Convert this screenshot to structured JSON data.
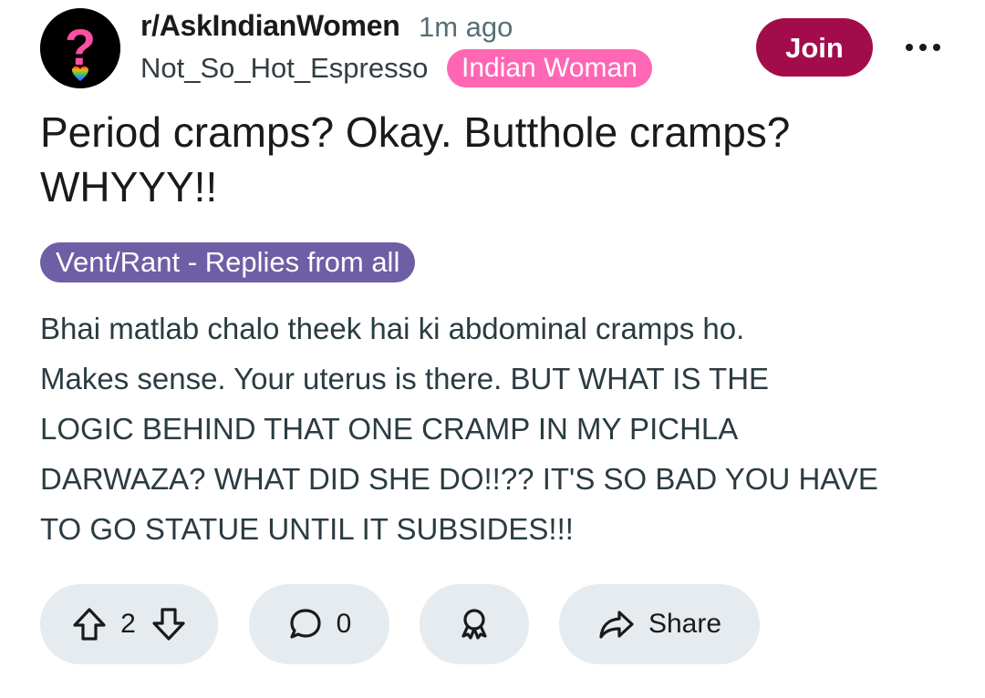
{
  "header": {
    "subreddit": "r/AskIndianWomen",
    "time_ago": "1m ago",
    "username": "Not_So_Hot_Espresso",
    "user_flair": "Indian Woman",
    "join_label": "Join",
    "avatar_icon": "question-mark-heart-icon",
    "more_icon": "more-horizontal-icon"
  },
  "post": {
    "title_line1": "Period cramps? Okay. Butthole cramps?",
    "title_line2": "WHYYY!!",
    "flair": "Vent/Rant - Replies from all",
    "body_lines": [
      "Bhai matlab chalo theek hai ki abdominal cramps ho.",
      "Makes sense. Your uterus is there. BUT WHAT IS THE",
      "LOGIC BEHIND THAT ONE CRAMP IN MY PICHLA",
      "DARWAZA? WHAT DID SHE DO!!?? IT'S SO BAD YOU HAVE",
      "TO GO STATUE UNTIL IT SUBSIDES!!!"
    ]
  },
  "actions": {
    "vote_count": "2",
    "comment_count": "0",
    "share_label": "Share",
    "upvote_icon": "upvote-arrow-icon",
    "downvote_icon": "downvote-arrow-icon",
    "comment_icon": "comment-bubble-icon",
    "award_icon": "award-icon",
    "share_icon": "share-arrow-icon"
  },
  "colors": {
    "join_button": "#a30c4b",
    "user_flair_bg": "#ff66b3",
    "post_flair_bg": "#6e5ea5",
    "action_pill_bg": "#e5ebee",
    "body_text": "#2a3c42",
    "meta_text": "#576f76"
  }
}
